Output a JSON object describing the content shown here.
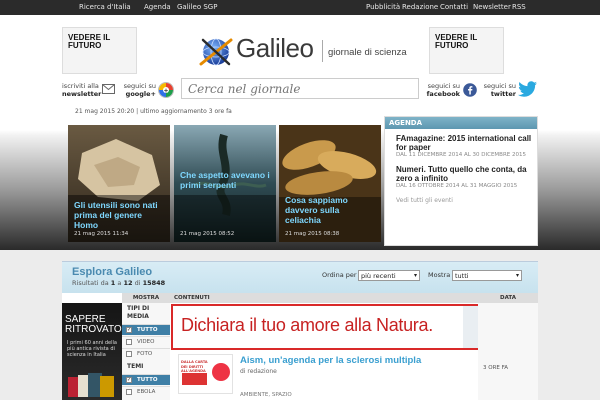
{
  "topnav": {
    "left": [
      "Ricerca d'Italia",
      "Agenda",
      "Galileo SGP"
    ],
    "right": [
      "Pubblicità",
      "Redazione",
      "Contatti",
      "Newsletter",
      "RSS"
    ]
  },
  "ads": {
    "left": "VEDERE IL FUTURO",
    "right": "VEDERE IL FUTURO"
  },
  "logo": {
    "name": "Galileo",
    "tagline": "giornale di scienza"
  },
  "social": {
    "newsletter_top": "iscriviti alla",
    "newsletter_bottom": "newsletter",
    "google_top": "seguici su",
    "google_bottom": "google+",
    "facebook_top": "seguici su",
    "facebook_bottom": "facebook",
    "twitter_top": "seguici su",
    "twitter_bottom": "twitter"
  },
  "search": {
    "placeholder": "Cerca nel giornale"
  },
  "dateline": "21 mag 2015 20:20 | ultimo aggiornamento 3 ore fa",
  "featured": [
    {
      "title": "Gli utensili sono nati prima del genere Homo",
      "date": "21 mag 2015 11:34"
    },
    {
      "title": "Che aspetto avevano i primi serpenti",
      "date": "21 mag 2015 08:52"
    },
    {
      "title": "Cosa sappiamo davvero sulla celiachia",
      "date": "21 mag 2015 08:38"
    }
  ],
  "agenda": {
    "heading": "AGENDA",
    "items": [
      {
        "title": "FAmagazine: 2015 international call for paper",
        "dates": "DAL 11 DICEMBRE 2014 AL 30 DICEMBRE 2015"
      },
      {
        "title": "Numeri. Tutto quello che conta, da zero a infinito",
        "dates": "DAL 16 OTTOBRE 2014 AL 31 MAGGIO 2015"
      }
    ],
    "more": "Vedi tutti gli eventi"
  },
  "explore": {
    "heading": "Esplora Galileo",
    "results_prefix": "Risultati da",
    "from": "1",
    "mid": "a",
    "to": "12",
    "of": "di",
    "total": "15848",
    "order_label": "Ordina per",
    "order_value": "più recenti",
    "show_label": "Mostra",
    "show_value": "tutti"
  },
  "columns": {
    "mostra": "MOSTRA",
    "contenuti": "CONTENUTI",
    "data": "DATA"
  },
  "saper": {
    "title": "SAPERE RITROVATO",
    "desc": "I primi 60 anni della più antica rivista di scienza in Italia"
  },
  "filters": {
    "media_label": "TIPI DI MEDIA",
    "media": [
      {
        "label": "TUTTO",
        "checked": true
      },
      {
        "label": "VIDEO",
        "checked": false
      },
      {
        "label": "FOTO",
        "checked": false
      }
    ],
    "themes_label": "TEMI",
    "themes": [
      {
        "label": "TUTTO",
        "checked": true
      },
      {
        "label": "EBOLA",
        "checked": false
      }
    ]
  },
  "banner": {
    "text": "Dichiara il tuo amore alla Natura."
  },
  "article": {
    "title": "Aism, un'agenda per la sclerosi multipla",
    "by": "di redazione",
    "tags": "AMBIENTE, SPAZIO",
    "time": "3 ORE FA",
    "thumb_text": "DALLA CARTA DEI DIRITTI ALL'AGENDA"
  },
  "colors": {
    "topbar": "#2b2b2b",
    "link_blue": "#3a9fd0",
    "feature_title": "#7fd8ff",
    "banner_red": "#d92929",
    "filter_on": "#3f7fa6"
  }
}
